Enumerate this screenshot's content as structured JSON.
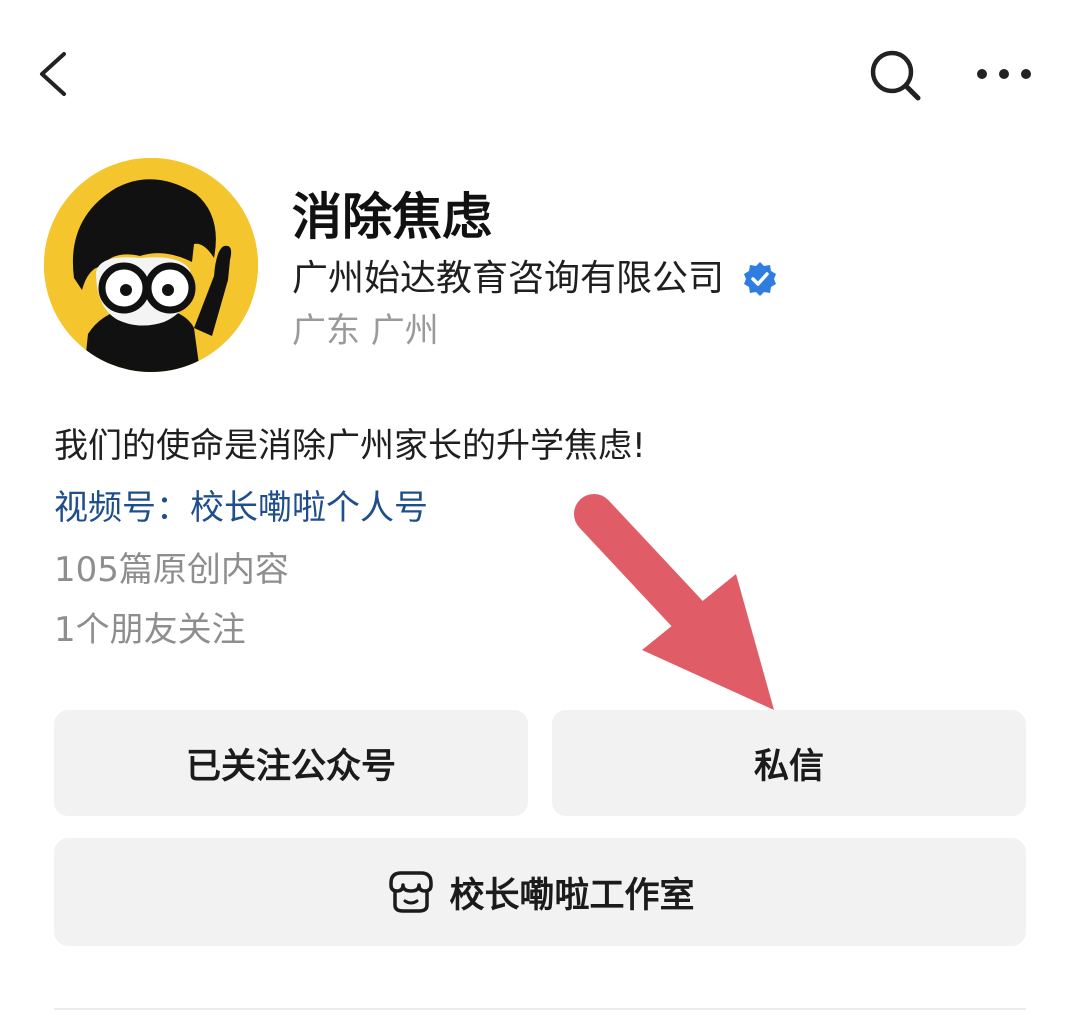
{
  "account": {
    "name": "消除焦虑",
    "company": "广州始达教育咨询有限公司",
    "location": "广东 广州",
    "verified": true
  },
  "bio": {
    "description": "我们的使命是消除广州家长的升学焦虑!",
    "channel": "视频号：校长嘞啦个人号",
    "original_count": "105篇原创内容",
    "friends_following": "1个朋友关注"
  },
  "actions": {
    "follow_label": "已关注公众号",
    "message_label": "私信",
    "studio_label": "校长嘞啦工作室"
  },
  "icons": {
    "back": "chevron-left-icon",
    "search": "search-icon",
    "more": "more-dots-icon",
    "verified": "verified-badge-icon",
    "studio": "shop-icon"
  },
  "colors": {
    "verified_blue": "#2f7de1",
    "link_blue": "#1f4e8c",
    "avatar_yellow": "#f5c52d",
    "button_gray": "#f2f2f2",
    "annotation_red": "#e05d67"
  }
}
